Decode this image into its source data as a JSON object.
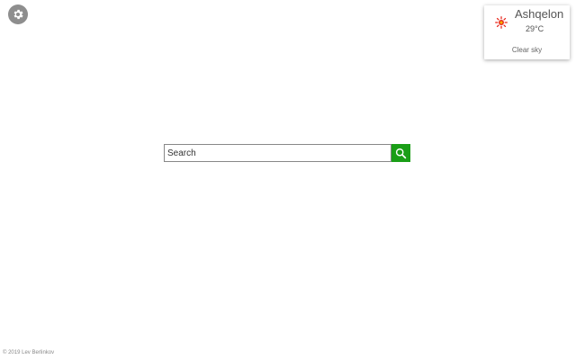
{
  "settings": {
    "icon": "gear-icon",
    "color": "#8e8e8e"
  },
  "weather": {
    "city": "Ashqelon",
    "temperature": "29°C",
    "description": "Clear sky",
    "icon": "sun-icon",
    "icon_color": "#e8261b"
  },
  "search": {
    "placeholder": "Search",
    "value": "",
    "button_icon": "magnifier-icon",
    "button_color": "#1a9e17"
  },
  "footer": {
    "copyright": "© 2019 Lev Berlinkov"
  }
}
